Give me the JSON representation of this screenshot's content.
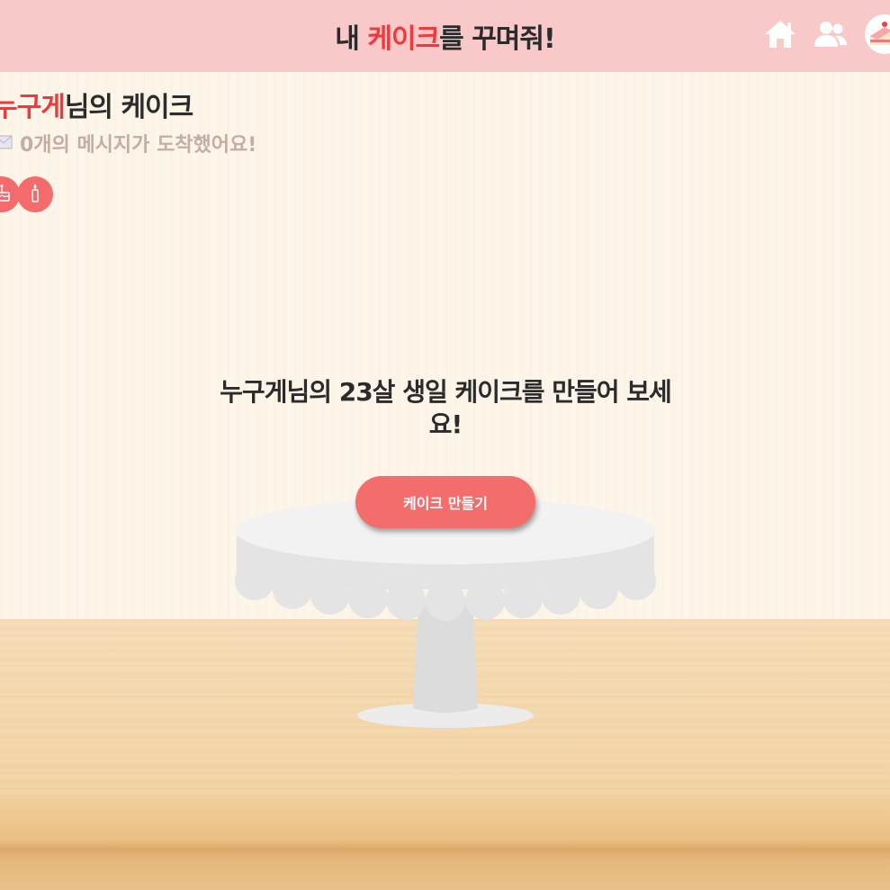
{
  "header": {
    "title_prefix": "내 ",
    "title_accent": "케이크",
    "title_suffix": "를 꾸며줘!",
    "icons": {
      "home": "home-icon",
      "users": "users-icon",
      "avatar": "cake-avatar-icon"
    }
  },
  "owner": {
    "name": "누구게",
    "title_suffix": "님의 케이크",
    "message_count_text": "0개의 메시지가 도착했어요!"
  },
  "actions": {
    "cake_icon": "cake-icon",
    "candle_icon": "candle-icon"
  },
  "main": {
    "prompt": "누구게님의 23살 생일 케이크를 만들어 보세요!",
    "make_button": "케이크 만들기"
  },
  "colors": {
    "header_bg": "#f9c8c8",
    "accent_red": "#f0393c",
    "button_coral": "#f46d6d",
    "message_text": "#c4ada2",
    "wall": "#fdf6ea",
    "table": "#f4d6a8"
  }
}
